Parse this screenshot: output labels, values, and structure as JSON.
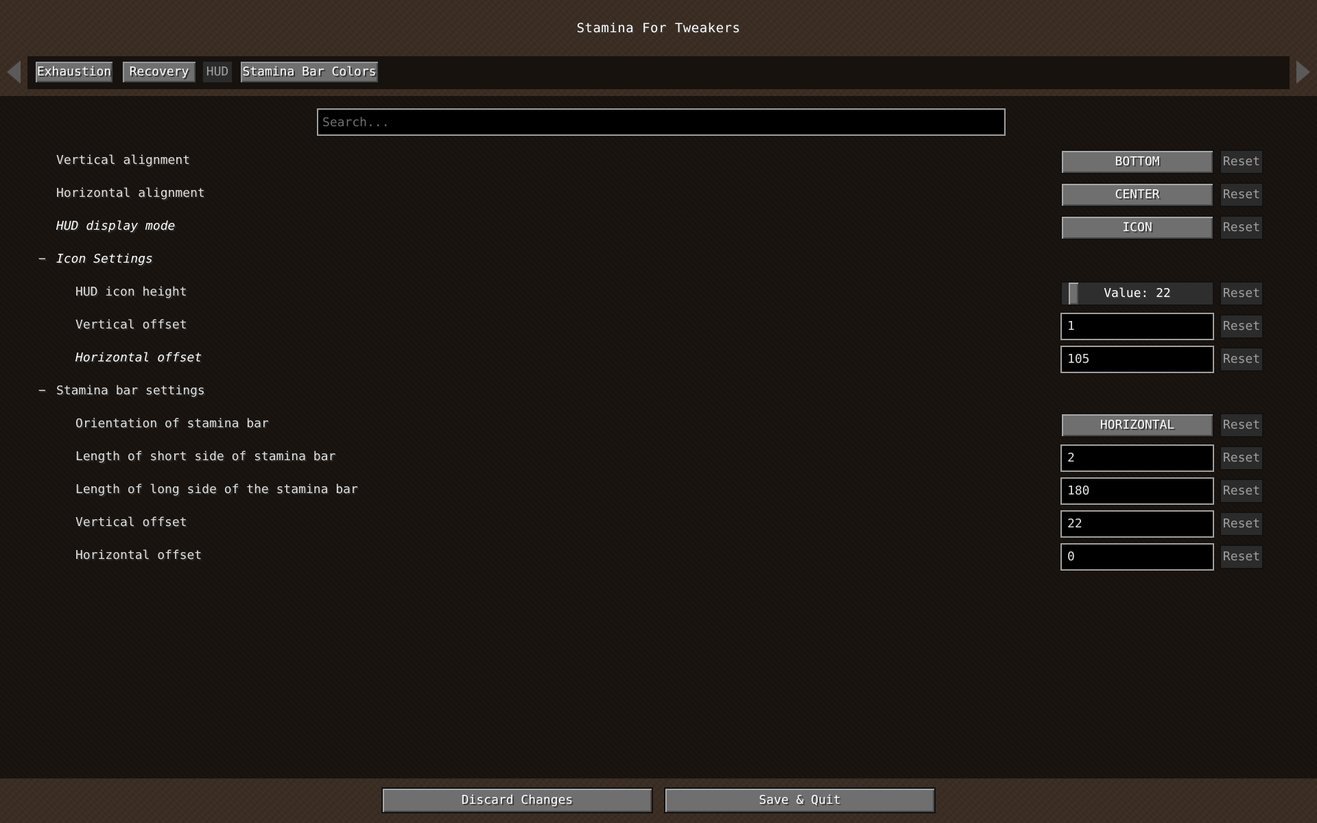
{
  "window": {
    "title": "Stamina For Tweakers"
  },
  "tabs": [
    {
      "label": "Exhaustion",
      "active": false
    },
    {
      "label": "Recovery",
      "active": false
    },
    {
      "label": "HUD",
      "active": true
    },
    {
      "label": "Stamina Bar Colors",
      "active": false
    }
  ],
  "search": {
    "placeholder": "Search...",
    "value": ""
  },
  "rows": {
    "vertical_alignment": {
      "label": "Vertical alignment",
      "value": "BOTTOM"
    },
    "horizontal_alignment": {
      "label": "Horizontal alignment",
      "value": "CENTER"
    },
    "hud_display_mode": {
      "label": "HUD display mode",
      "value": "ICON"
    },
    "icon_settings": {
      "toggle": "−",
      "label": "Icon Settings"
    },
    "hud_icon_height": {
      "label": "HUD icon height",
      "value_text": "Value: 22",
      "value": 22
    },
    "icon_vertical_offset": {
      "label": "Vertical offset",
      "value": "1"
    },
    "icon_horizontal_offset": {
      "label": "Horizontal offset",
      "value": "105"
    },
    "stamina_bar_settings": {
      "toggle": "−",
      "label": "Stamina bar settings"
    },
    "orientation": {
      "label": "Orientation of stamina bar",
      "value": "HORIZONTAL"
    },
    "short_side": {
      "label": "Length of short side of stamina bar",
      "value": "2"
    },
    "long_side": {
      "label": "Length of long side of the stamina bar",
      "value": "180"
    },
    "bar_vertical_offset": {
      "label": "Vertical offset",
      "value": "22"
    },
    "bar_horizontal_offset": {
      "label": "Horizontal offset",
      "value": "0"
    }
  },
  "reset_label": "Reset",
  "footer": {
    "discard_label": "Discard Changes",
    "save_label": "Save & Quit"
  },
  "icons": {
    "tab_left": "triangle-left-icon",
    "tab_right": "triangle-right-icon"
  }
}
